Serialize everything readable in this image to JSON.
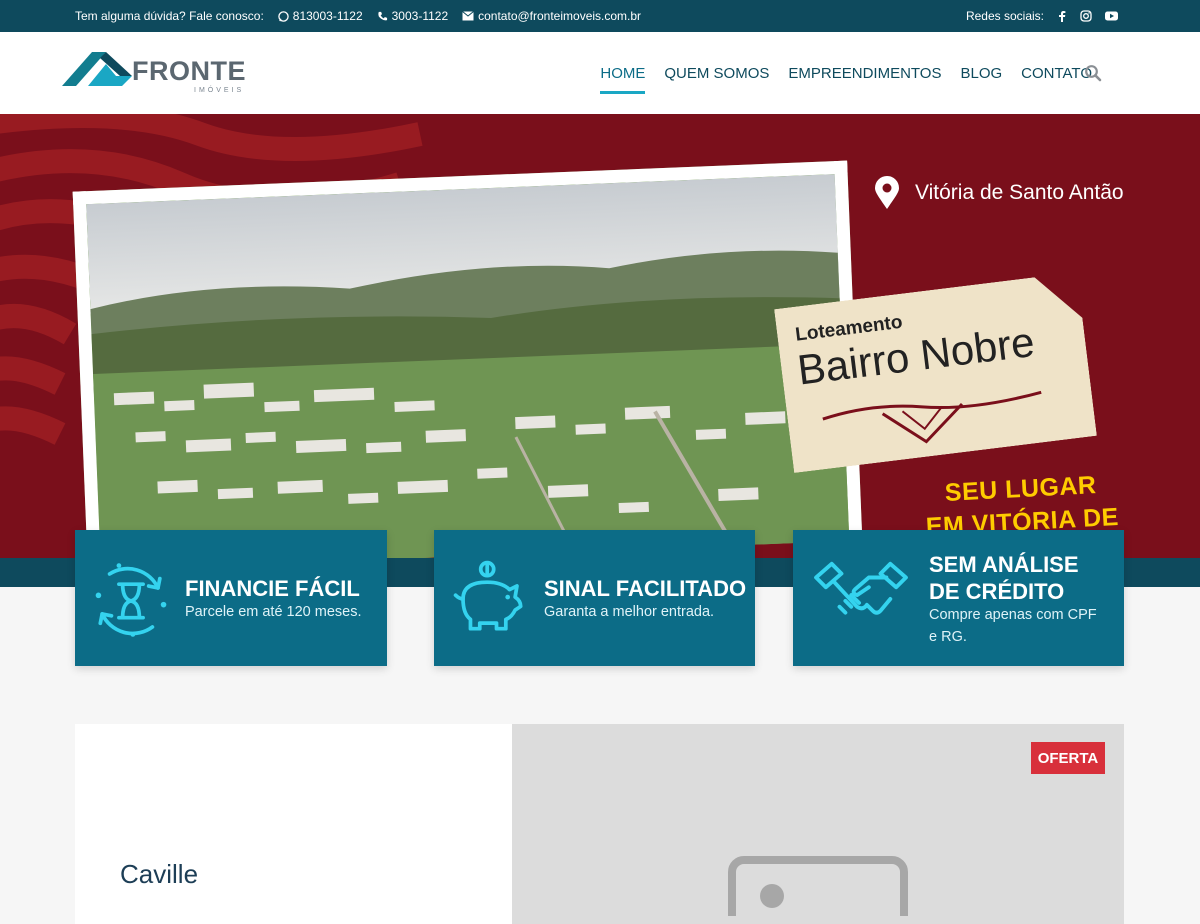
{
  "topbar": {
    "question": "Tem alguma dúvida? Fale conosco:",
    "whatsapp": "813003-1122",
    "phone": "3003-1122",
    "email": "contato@fronteimoveis.com.br",
    "social_label": "Redes sociais:",
    "social_icons": [
      "facebook-icon",
      "instagram-icon",
      "youtube-icon"
    ]
  },
  "logo": {
    "word": "FRONTE",
    "sub": "IMÓVEIS"
  },
  "nav": {
    "items": [
      {
        "label": "HOME",
        "active": true
      },
      {
        "label": "QUEM SOMOS"
      },
      {
        "label": "EMPREENDIMENTOS"
      },
      {
        "label": "BLOG"
      },
      {
        "label": "CONTATO"
      }
    ]
  },
  "hero": {
    "location": "Vitória de Santo Antão",
    "tag_line1": "Loteamento",
    "tag_line2": "Bairro Nobre",
    "slogan_line1": "SEU LUGAR",
    "slogan_line2": "EM VITÓRIA DE"
  },
  "features": [
    {
      "title": "FINANCIE FÁCIL",
      "desc": "Parcele em até 120 meses.",
      "icon": "hourglass-cycle-icon"
    },
    {
      "title": "SINAL FACILITADO",
      "desc": "Garanta a melhor entrada.",
      "icon": "piggy-bank-icon"
    },
    {
      "title_line1": "SEM ANÁLISE",
      "title_line2": "DE CRÉDITO",
      "desc_line1": "Compre apenas com CPF",
      "desc_line2": "e RG.",
      "icon": "handshake-icon"
    }
  ],
  "listing": {
    "title": "Caville",
    "badge": "OFERTA"
  },
  "colors": {
    "topbar": "#0e4a5d",
    "accent": "#1aa7c4",
    "feature_bg": "#0c6c87",
    "hero_bg": "#7a0f1b",
    "badge": "#d8303b"
  }
}
